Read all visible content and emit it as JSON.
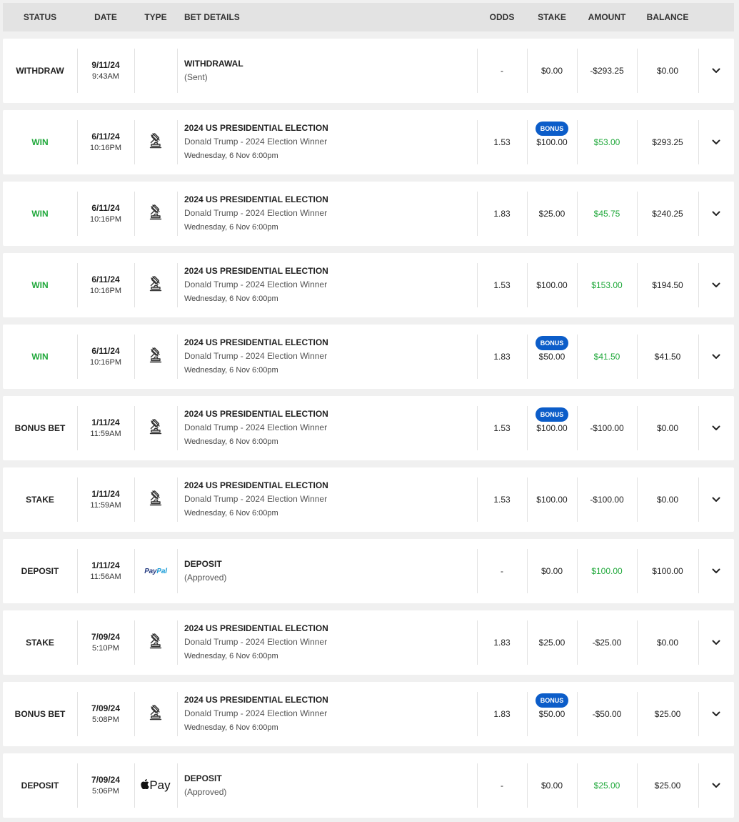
{
  "headers": {
    "status": "STATUS",
    "date": "DATE",
    "type": "TYPE",
    "details": "BET DETAILS",
    "odds": "ODDS",
    "stake": "STAKE",
    "amount": "AMOUNT",
    "balance": "BALANCE"
  },
  "colors": {
    "win": "#1fa83a",
    "bonus_badge": "#0c5dc9",
    "header_bg": "#e3e3e3"
  },
  "rows": [
    {
      "status": "WITHDRAW",
      "win": false,
      "date": "9/11/24",
      "time": "9:43AM",
      "type_icon": "none",
      "line1": "WITHDRAWAL",
      "line2": "(Sent)",
      "line3": "",
      "odds": "-",
      "bonus": "",
      "stake": "$0.00",
      "amount": "-$293.25",
      "amount_positive": false,
      "balance": "$0.00"
    },
    {
      "status": "WIN",
      "win": true,
      "date": "6/11/24",
      "time": "10:16PM",
      "type_icon": "gavel-icon",
      "line1": "2024 US PRESIDENTIAL ELECTION",
      "line2": "Donald Trump - 2024 Election Winner",
      "line3": "Wednesday, 6 Nov 6:00pm",
      "odds": "1.53",
      "bonus": "BONUS",
      "stake": "$100.00",
      "amount": "$53.00",
      "amount_positive": true,
      "balance": "$293.25"
    },
    {
      "status": "WIN",
      "win": true,
      "date": "6/11/24",
      "time": "10:16PM",
      "type_icon": "gavel-icon",
      "line1": "2024 US PRESIDENTIAL ELECTION",
      "line2": "Donald Trump - 2024 Election Winner",
      "line3": "Wednesday, 6 Nov 6:00pm",
      "odds": "1.83",
      "bonus": "",
      "stake": "$25.00",
      "amount": "$45.75",
      "amount_positive": true,
      "balance": "$240.25"
    },
    {
      "status": "WIN",
      "win": true,
      "date": "6/11/24",
      "time": "10:16PM",
      "type_icon": "gavel-icon",
      "line1": "2024 US PRESIDENTIAL ELECTION",
      "line2": "Donald Trump - 2024 Election Winner",
      "line3": "Wednesday, 6 Nov 6:00pm",
      "odds": "1.53",
      "bonus": "",
      "stake": "$100.00",
      "amount": "$153.00",
      "amount_positive": true,
      "balance": "$194.50"
    },
    {
      "status": "WIN",
      "win": true,
      "date": "6/11/24",
      "time": "10:16PM",
      "type_icon": "gavel-icon",
      "line1": "2024 US PRESIDENTIAL ELECTION",
      "line2": "Donald Trump - 2024 Election Winner",
      "line3": "Wednesday, 6 Nov 6:00pm",
      "odds": "1.83",
      "bonus": "BONUS",
      "stake": "$50.00",
      "amount": "$41.50",
      "amount_positive": true,
      "balance": "$41.50"
    },
    {
      "status": "BONUS BET",
      "win": false,
      "date": "1/11/24",
      "time": "11:59AM",
      "type_icon": "gavel-icon",
      "line1": "2024 US PRESIDENTIAL ELECTION",
      "line2": "Donald Trump - 2024 Election Winner",
      "line3": "Wednesday, 6 Nov 6:00pm",
      "odds": "1.53",
      "bonus": "BONUS",
      "stake": "$100.00",
      "amount": "-$100.00",
      "amount_positive": false,
      "balance": "$0.00"
    },
    {
      "status": "STAKE",
      "win": false,
      "date": "1/11/24",
      "time": "11:59AM",
      "type_icon": "gavel-icon",
      "line1": "2024 US PRESIDENTIAL ELECTION",
      "line2": "Donald Trump - 2024 Election Winner",
      "line3": "Wednesday, 6 Nov 6:00pm",
      "odds": "1.53",
      "bonus": "",
      "stake": "$100.00",
      "amount": "-$100.00",
      "amount_positive": false,
      "balance": "$0.00"
    },
    {
      "status": "DEPOSIT",
      "win": false,
      "date": "1/11/24",
      "time": "11:56AM",
      "type_icon": "paypal-logo",
      "type_text": [
        "Pay",
        "Pal"
      ],
      "line1": "DEPOSIT",
      "line2": "(Approved)",
      "line3": "",
      "odds": "-",
      "bonus": "",
      "stake": "$0.00",
      "amount": "$100.00",
      "amount_positive": true,
      "balance": "$100.00"
    },
    {
      "status": "STAKE",
      "win": false,
      "date": "7/09/24",
      "time": "5:10PM",
      "type_icon": "gavel-icon",
      "line1": "2024 US PRESIDENTIAL ELECTION",
      "line2": "Donald Trump - 2024 Election Winner",
      "line3": "Wednesday, 6 Nov 6:00pm",
      "odds": "1.83",
      "bonus": "",
      "stake": "$25.00",
      "amount": "-$25.00",
      "amount_positive": false,
      "balance": "$0.00"
    },
    {
      "status": "BONUS BET",
      "win": false,
      "date": "7/09/24",
      "time": "5:08PM",
      "type_icon": "gavel-icon",
      "line1": "2024 US PRESIDENTIAL ELECTION",
      "line2": "Donald Trump - 2024 Election Winner",
      "line3": "Wednesday, 6 Nov 6:00pm",
      "odds": "1.83",
      "bonus": "BONUS",
      "stake": "$50.00",
      "amount": "-$50.00",
      "amount_positive": false,
      "balance": "$25.00"
    },
    {
      "status": "DEPOSIT",
      "win": false,
      "date": "7/09/24",
      "time": "5:06PM",
      "type_icon": "apple-pay-logo",
      "type_text": [
        "Pay"
      ],
      "line1": "DEPOSIT",
      "line2": "(Approved)",
      "line3": "",
      "odds": "-",
      "bonus": "",
      "stake": "$0.00",
      "amount": "$25.00",
      "amount_positive": true,
      "balance": "$25.00"
    }
  ]
}
